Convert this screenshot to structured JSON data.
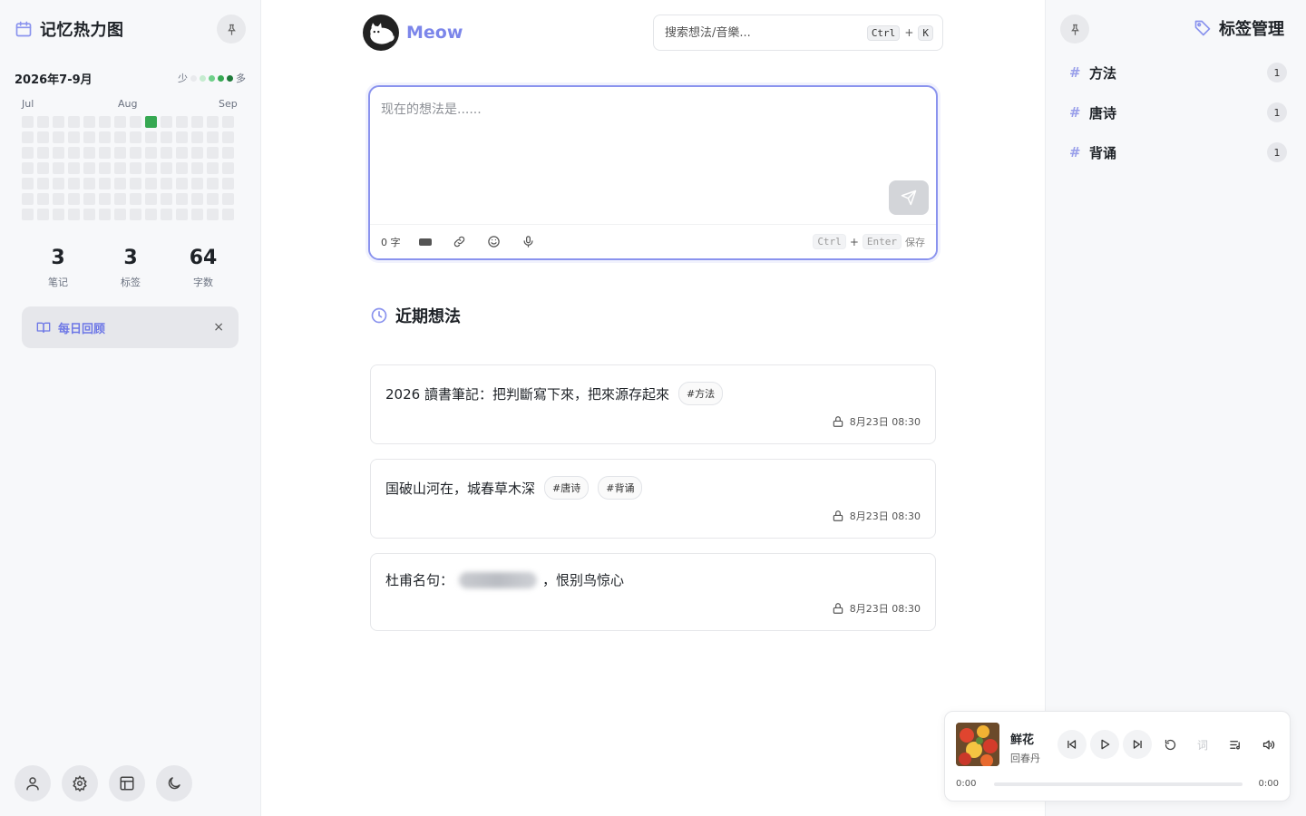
{
  "heatmap": {
    "title": "记忆热力图",
    "range": "2026年7-9月",
    "legend_less": "少",
    "legend_more": "多",
    "legend_colors": [
      "#e9eaed",
      "#c6ecd0",
      "#6fd08a",
      "#36a852",
      "#1e7a39"
    ],
    "months": [
      "Jul",
      "Aug",
      "Sep"
    ],
    "active_cells": [
      8
    ]
  },
  "stats": [
    {
      "value": "3",
      "label": "笔记"
    },
    {
      "value": "3",
      "label": "标签"
    },
    {
      "value": "64",
      "label": "字数"
    }
  ],
  "daily_review": {
    "label": "每日回顾",
    "close": "×"
  },
  "brand": {
    "name": "Meow"
  },
  "search": {
    "placeholder": "搜索想法/音樂...",
    "key1": "Ctrl",
    "plus": "+",
    "key2": "K"
  },
  "editor": {
    "placeholder": "现在的想法是......",
    "word_count": "0 字",
    "save_key1": "Ctrl",
    "save_plus": "+",
    "save_key2": "Enter",
    "save_label": "保存"
  },
  "recent": {
    "title": "近期想法",
    "notes": [
      {
        "text": "2026 讀書筆記：把判斷寫下來，把來源存起來",
        "tags": [
          "#方法"
        ],
        "time": "8月23日 08:30"
      },
      {
        "text": "国破山河在，城春草木深",
        "tags": [
          "#唐诗",
          "#背诵"
        ],
        "time": "8月23日 08:30"
      },
      {
        "text_before": "杜甫名句：",
        "text_after": "，恨别鸟惊心",
        "time": "8月23日 08:30"
      }
    ]
  },
  "tags_panel": {
    "title": "标签管理",
    "hash": "#",
    "items": [
      {
        "name": "方法",
        "count": "1"
      },
      {
        "name": "唐诗",
        "count": "1"
      },
      {
        "name": "背诵",
        "count": "1"
      }
    ]
  },
  "player": {
    "title": "鲜花",
    "artist": "回春丹",
    "lyric_label": "词",
    "current_time": "0:00",
    "total_time": "0:00",
    "progress": 0
  },
  "colors": {
    "accent": "#7c86ea",
    "heat_active": "#36a852"
  }
}
